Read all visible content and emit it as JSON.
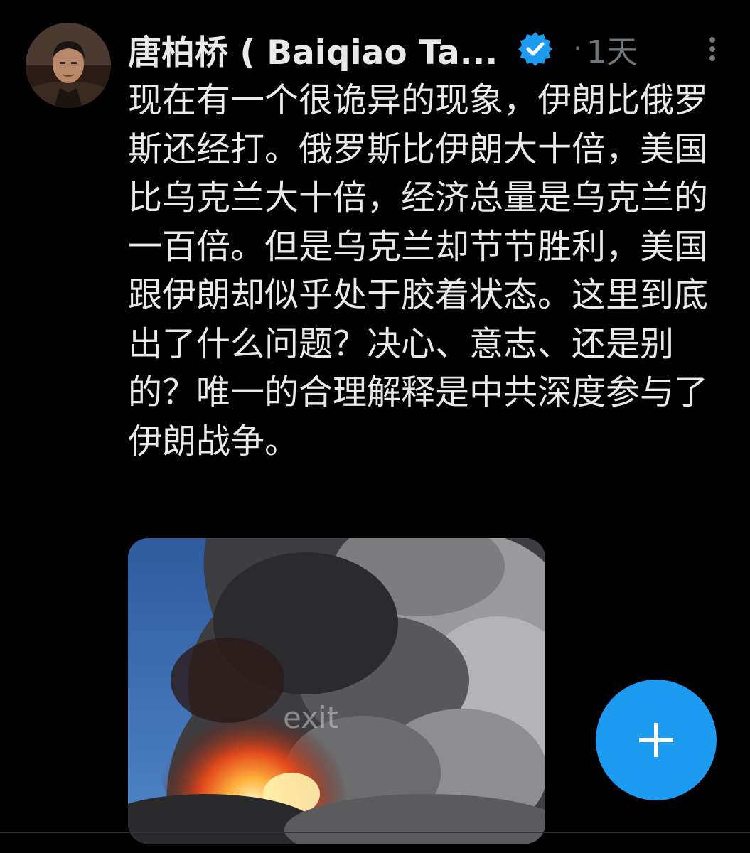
{
  "tweet": {
    "author": {
      "display_name": "唐柏桥 ( Baiqiao Ta...",
      "verified": true,
      "avatar_icon": "avatar-photo"
    },
    "separator": "·",
    "timestamp": "1天",
    "text": "现在有一个很诡异的现象，伊朗比俄罗斯还经打。俄罗斯比伊朗大十倍，美国比乌克兰大十倍，经济总量是乌克兰的一百倍。但是乌克兰却节节胜利，美国跟伊朗却似乎处于胶着状态。这里到底出了什么问题？决心、意志、还是别的？唯一的合理解释是中共深度参与了伊朗战争。",
    "media": {
      "watermark": "exit"
    }
  },
  "fab": {
    "icon": "plus-icon"
  },
  "colors": {
    "background": "#000000",
    "text": "#e7e9ea",
    "secondary": "#71767b",
    "accent": "#1d9bf0"
  }
}
